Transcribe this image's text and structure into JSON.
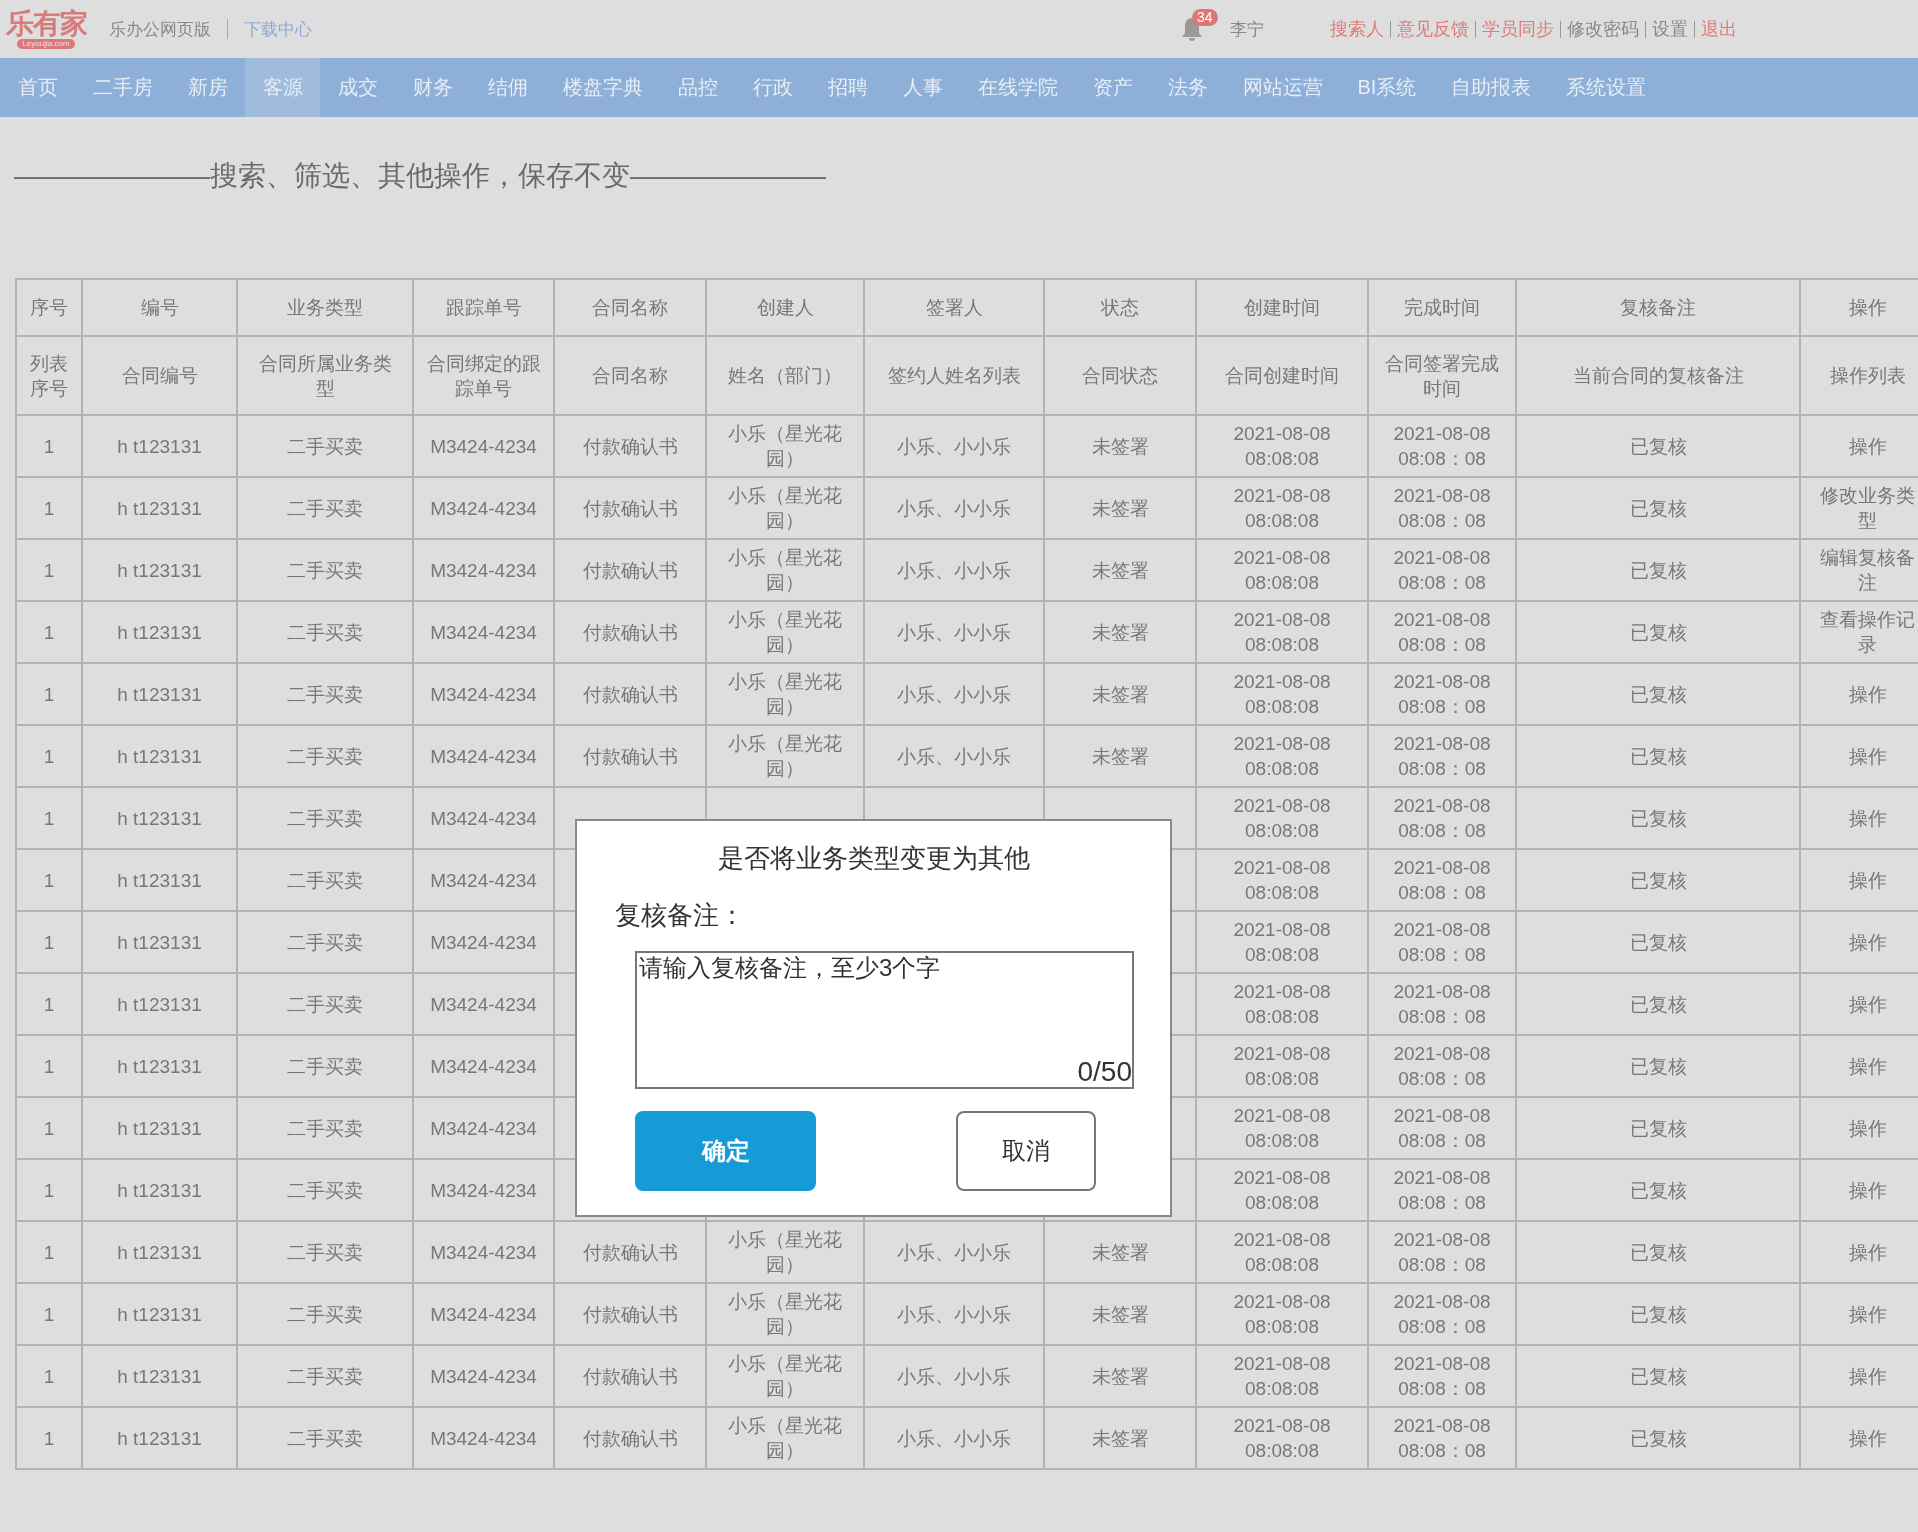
{
  "header": {
    "logo": "乐有家",
    "logo_domain": "Leyoujia.com",
    "app_name": "乐办公网页版",
    "download_link": "下载中心",
    "notification_count": "34",
    "user": "李宁",
    "links": [
      {
        "label": "搜索人",
        "highlighted": true
      },
      {
        "label": "意见反馈",
        "highlighted": true
      },
      {
        "label": "学员同步",
        "highlighted": true
      },
      {
        "label": "修改密码",
        "highlighted": false
      },
      {
        "label": "设置",
        "highlighted": false
      },
      {
        "label": "退出",
        "highlighted": true
      }
    ]
  },
  "nav": [
    {
      "label": "首页",
      "selected": false
    },
    {
      "label": "二手房",
      "selected": false
    },
    {
      "label": "新房",
      "selected": false
    },
    {
      "label": "客源",
      "selected": true
    },
    {
      "label": "成交",
      "selected": false
    },
    {
      "label": "财务",
      "selected": false
    },
    {
      "label": "结佣",
      "selected": false
    },
    {
      "label": "楼盘字典",
      "selected": false
    },
    {
      "label": "品控",
      "selected": false
    },
    {
      "label": "行政",
      "selected": false
    },
    {
      "label": "招聘",
      "selected": false
    },
    {
      "label": "人事",
      "selected": false
    },
    {
      "label": "在线学院",
      "selected": false
    },
    {
      "label": "资产",
      "selected": false
    },
    {
      "label": "法务",
      "selected": false
    },
    {
      "label": "网站运营",
      "selected": false
    },
    {
      "label": "BI系统",
      "selected": false
    },
    {
      "label": "自助报表",
      "selected": false
    },
    {
      "label": "系统设置",
      "selected": false
    }
  ],
  "note": "———————搜索、筛选、其他操作，保存不变———————",
  "table": {
    "columns": [
      "序号",
      "编号",
      "业务类型",
      "跟踪单号",
      "合同名称",
      "创建人",
      "签署人",
      "状态",
      "创建时间",
      "完成时间",
      "复核备注",
      "操作"
    ],
    "column_descriptions": [
      "列表序号",
      "合同编号",
      "合同所属业务类型",
      "合同绑定的跟踪单号",
      "合同名称",
      "姓名（部门）",
      "签约人姓名列表",
      "合同状态",
      "合同创建时间",
      "合同签署完成时间",
      "当前合同的复核备注",
      "操作列表"
    ],
    "rows": [
      [
        "1",
        "h t123131",
        "二手买卖",
        "M3424-4234",
        "付款确认书",
        "小乐（星光花园）",
        "小乐、小小乐",
        "未签署",
        "2021-08-08 08:08:08",
        "2021-08-08 08:08：08",
        "已复核",
        "操作"
      ],
      [
        "1",
        "h t123131",
        "二手买卖",
        "M3424-4234",
        "付款确认书",
        "小乐（星光花园）",
        "小乐、小小乐",
        "未签署",
        "2021-08-08 08:08:08",
        "2021-08-08 08:08：08",
        "已复核",
        "修改业务类型"
      ],
      [
        "1",
        "h t123131",
        "二手买卖",
        "M3424-4234",
        "付款确认书",
        "小乐（星光花园）",
        "小乐、小小乐",
        "未签署",
        "2021-08-08 08:08:08",
        "2021-08-08 08:08：08",
        "已复核",
        "编辑复核备注"
      ],
      [
        "1",
        "h t123131",
        "二手买卖",
        "M3424-4234",
        "付款确认书",
        "小乐（星光花园）",
        "小乐、小小乐",
        "未签署",
        "2021-08-08 08:08:08",
        "2021-08-08 08:08：08",
        "已复核",
        "查看操作记录"
      ],
      [
        "1",
        "h t123131",
        "二手买卖",
        "M3424-4234",
        "付款确认书",
        "小乐（星光花园）",
        "小乐、小小乐",
        "未签署",
        "2021-08-08 08:08:08",
        "2021-08-08 08:08：08",
        "已复核",
        "操作"
      ],
      [
        "1",
        "h t123131",
        "二手买卖",
        "M3424-4234",
        "付款确认书",
        "小乐（星光花园）",
        "小乐、小小乐",
        "未签署",
        "2021-08-08 08:08:08",
        "2021-08-08 08:08：08",
        "已复核",
        "操作"
      ],
      [
        "1",
        "h t123131",
        "二手买卖",
        "M3424-4234",
        null,
        null,
        null,
        null,
        "2021-08-08 08:08:08",
        "2021-08-08 08:08：08",
        "已复核",
        "操作"
      ],
      [
        "1",
        "h t123131",
        "二手买卖",
        "M3424-4234",
        null,
        null,
        null,
        null,
        "2021-08-08 08:08:08",
        "2021-08-08 08:08：08",
        "已复核",
        "操作"
      ],
      [
        "1",
        "h t123131",
        "二手买卖",
        "M3424-4234",
        null,
        null,
        null,
        null,
        "2021-08-08 08:08:08",
        "2021-08-08 08:08：08",
        "已复核",
        "操作"
      ],
      [
        "1",
        "h t123131",
        "二手买卖",
        "M3424-4234",
        null,
        null,
        null,
        null,
        "2021-08-08 08:08:08",
        "2021-08-08 08:08：08",
        "已复核",
        "操作"
      ],
      [
        "1",
        "h t123131",
        "二手买卖",
        "M3424-4234",
        null,
        null,
        null,
        null,
        "2021-08-08 08:08:08",
        "2021-08-08 08:08：08",
        "已复核",
        "操作"
      ],
      [
        "1",
        "h t123131",
        "二手买卖",
        "M3424-4234",
        null,
        null,
        null,
        null,
        "2021-08-08 08:08:08",
        "2021-08-08 08:08：08",
        "已复核",
        "操作"
      ],
      [
        "1",
        "h t123131",
        "二手买卖",
        "M3424-4234",
        null,
        null,
        null,
        null,
        "2021-08-08 08:08:08",
        "2021-08-08 08:08：08",
        "已复核",
        "操作"
      ],
      [
        "1",
        "h t123131",
        "二手买卖",
        "M3424-4234",
        "付款确认书",
        "小乐（星光花园）",
        "小乐、小小乐",
        "未签署",
        "2021-08-08 08:08:08",
        "2021-08-08 08:08：08",
        "已复核",
        "操作"
      ],
      [
        "1",
        "h t123131",
        "二手买卖",
        "M3424-4234",
        "付款确认书",
        "小乐（星光花园）",
        "小乐、小小乐",
        "未签署",
        "2021-08-08 08:08:08",
        "2021-08-08 08:08：08",
        "已复核",
        "操作"
      ],
      [
        "1",
        "h t123131",
        "二手买卖",
        "M3424-4234",
        "付款确认书",
        "小乐（星光花园）",
        "小乐、小小乐",
        "未签署",
        "2021-08-08 08:08:08",
        "2021-08-08 08:08：08",
        "已复核",
        "操作"
      ],
      [
        "1",
        "h t123131",
        "二手买卖",
        "M3424-4234",
        "付款确认书",
        "小乐（星光花园）",
        "小乐、小小乐",
        "未签署",
        "2021-08-08 08:08:08",
        "2021-08-08 08:08：08",
        "已复核",
        "操作"
      ]
    ]
  },
  "dialog": {
    "title": "是否将业务类型变更为其他",
    "label": "复核备注：",
    "placeholder": "请输入复核备注，至少3个字",
    "counter": "0/50",
    "confirm": "确定",
    "cancel": "取消"
  }
}
